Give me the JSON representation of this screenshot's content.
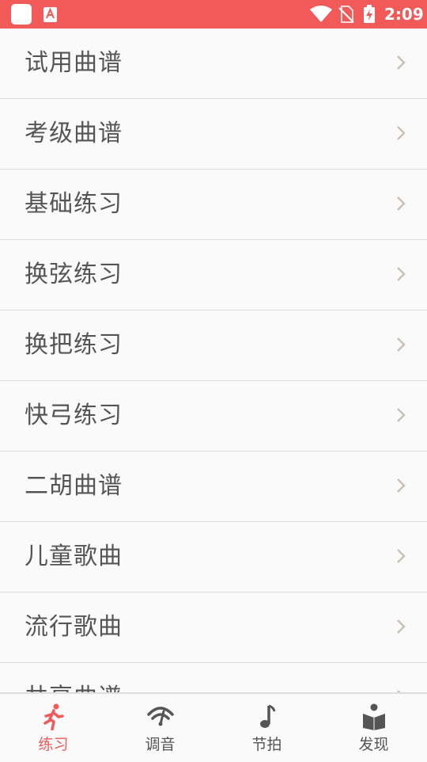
{
  "status_bar": {
    "time": "2:09",
    "background": "#f25a5a"
  },
  "list": {
    "items": [
      {
        "label": "试用曲谱"
      },
      {
        "label": "考级曲谱"
      },
      {
        "label": "基础练习"
      },
      {
        "label": "换弦练习"
      },
      {
        "label": "换把练习"
      },
      {
        "label": "快弓练习"
      },
      {
        "label": "二胡曲谱"
      },
      {
        "label": "儿童歌曲"
      },
      {
        "label": "流行歌曲"
      },
      {
        "label": "共享曲谱"
      }
    ],
    "chevron_icon": "chevron-right-icon"
  },
  "bottom_nav": {
    "items": [
      {
        "label": "练习",
        "icon": "running-person-icon",
        "active": true
      },
      {
        "label": "调音",
        "icon": "tuner-gauge-icon",
        "active": false
      },
      {
        "label": "节拍",
        "icon": "music-note-icon",
        "active": false
      },
      {
        "label": "发现",
        "icon": "book-reader-icon",
        "active": false
      }
    ],
    "active_color": "#f25a5a",
    "inactive_color": "#555555"
  }
}
